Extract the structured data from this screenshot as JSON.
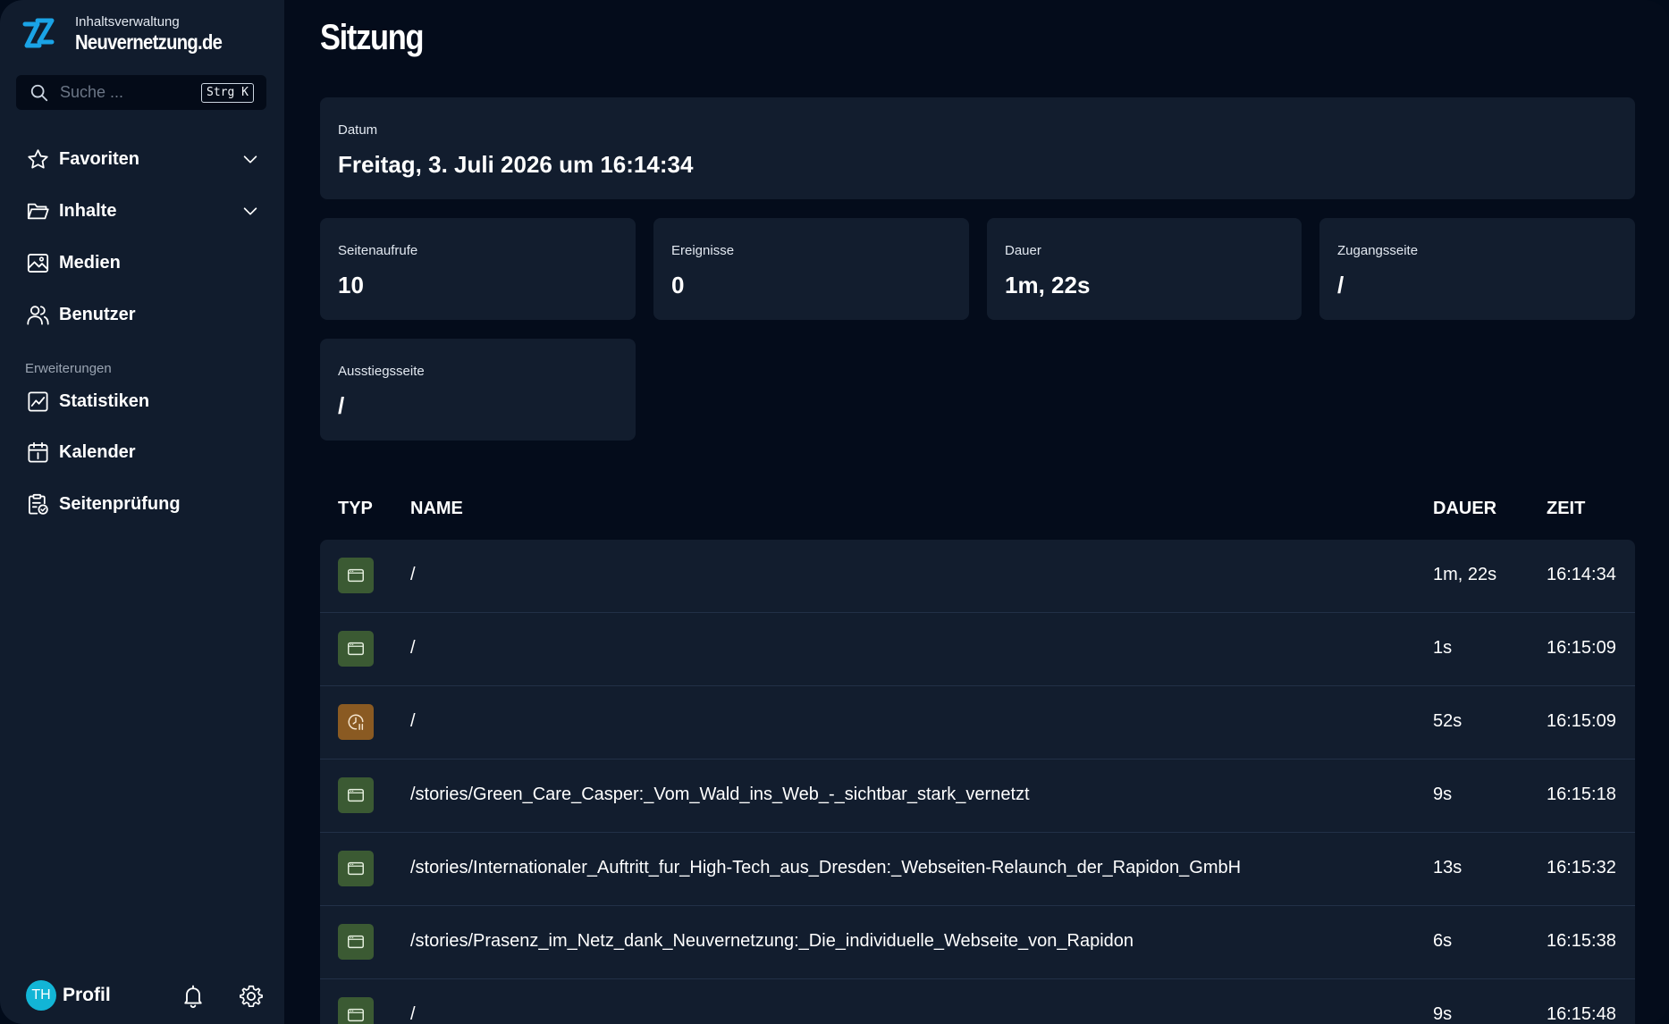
{
  "brand": {
    "subtitle": "Inhaltsverwaltung",
    "name": "Neuvernetzung.de"
  },
  "search": {
    "placeholder": "Suche ...",
    "shortcut": "Strg K"
  },
  "nav": {
    "favoriten": "Favoriten",
    "inhalte": "Inhalte",
    "medien": "Medien",
    "benutzer": "Benutzer",
    "section_erweiterungen": "Erweiterungen",
    "statistiken": "Statistiken",
    "kalender": "Kalender",
    "seitenpruefung": "Seitenprüfung"
  },
  "profile": {
    "initials": "TH",
    "label": "Profil"
  },
  "page": {
    "title": "Sitzung"
  },
  "session": {
    "date_label": "Datum",
    "date_value": "Freitag, 3. Juli 2026 um 16:14:34",
    "stats": [
      {
        "label": "Seitenaufrufe",
        "value": "10"
      },
      {
        "label": "Ereignisse",
        "value": "0"
      },
      {
        "label": "Dauer",
        "value": "1m, 22s"
      },
      {
        "label": "Zugangsseite",
        "value": "/"
      },
      {
        "label": "Ausstiegsseite",
        "value": "/"
      }
    ]
  },
  "table": {
    "headers": {
      "type": "TYP",
      "name": "NAME",
      "duration": "DAUER",
      "time": "ZEIT"
    },
    "rows": [
      {
        "type": "pageview",
        "name": "/",
        "duration": "1m, 22s",
        "time": "16:14:34"
      },
      {
        "type": "pageview",
        "name": "/",
        "duration": "1s",
        "time": "16:15:09"
      },
      {
        "type": "idle",
        "name": "/",
        "duration": "52s",
        "time": "16:15:09"
      },
      {
        "type": "pageview",
        "name": "/stories/Green_Care_Casper:_Vom_Wald_ins_Web_-_sichtbar_stark_vernetzt",
        "duration": "9s",
        "time": "16:15:18"
      },
      {
        "type": "pageview",
        "name": "/stories/Internationaler_Auftritt_fur_High-Tech_aus_Dresden:_Webseiten-Relaunch_der_Rapidon_GmbH",
        "duration": "13s",
        "time": "16:15:32"
      },
      {
        "type": "pageview",
        "name": "/stories/Prasenz_im_Netz_dank_Neuvernetzung:_Die_individuelle_Webseite_von_Rapidon",
        "duration": "6s",
        "time": "16:15:38"
      },
      {
        "type": "pageview",
        "name": "/",
        "duration": "9s",
        "time": "16:15:48"
      }
    ]
  },
  "colors": {
    "pageview_badge": "#3b5a33",
    "idle_badge": "#8a5a22",
    "accent": "#1aa3e6"
  }
}
